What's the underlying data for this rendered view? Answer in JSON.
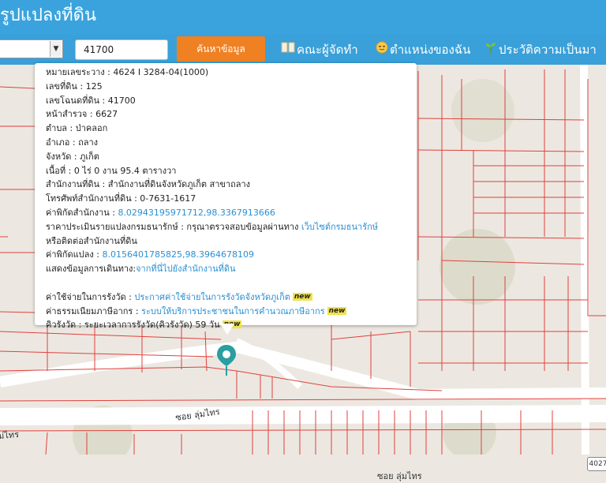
{
  "header": {
    "title": "รูปแปลงที่ดิน"
  },
  "toolbar": {
    "province_select_value": "",
    "deed_number_value": "41700",
    "search_button_label": "ค้นหาข้อมูล",
    "nav": [
      {
        "label": "คณะผู้จัดทำ",
        "icon": "book-icon"
      },
      {
        "label": "ตำแหน่งของฉัน",
        "icon": "face-icon"
      },
      {
        "label": "ประวัติความเป็นมา",
        "icon": "sprout-icon"
      }
    ]
  },
  "popup": {
    "survey_number": "หมายเลขระวาง : 4624 I 3284-04(1000)",
    "land_number": "เลขที่ดิน : 125",
    "deed_number": "เลขโฉนดที่ดิน : 41700",
    "survey_page": "หน้าสำรวจ : 6627",
    "subdistrict": "ตำบล : ป่าคลอก",
    "district": "อำเภอ : ถลาง",
    "province": "จังหวัด : ภูเก็ต",
    "area": "เนื้อที่ : 0 ไร่ 0 งาน 95.4 ตารางวา",
    "land_office": "สำนักงานที่ดิน : สำนักงานที่ดินจังหวัดภูเก็ต สาขาถลาง",
    "office_phone": "โทรศัพท์สำนักงานที่ดิน : 0-7631-1617",
    "office_coords_label": "ค่าพิกัดสำนักงาน : ",
    "office_coords_link": "8.02943195971712,98.3367913666",
    "appraisal_label": "ราคาประเมินรายแปลงกรมธนารักษ์ : กรุณาตรวจสอบข้อมูลผ่านทาง ",
    "appraisal_link": "เว็บไซต์กรมธนารักษ์",
    "appraisal_cont": "หรือติดต่อสำนักงานที่ดิน",
    "parcel_coords_label": "ค่าพิกัดแปลง : ",
    "parcel_coords_link": "8.0156401785825,98.3964678109",
    "directions_label": "แสดงข้อมูลการเดินทาง:",
    "directions_link": "จากที่นี่ไปยังสำนักงานที่ดิน",
    "fee_label": "ค่าใช้จ่ายในการรังวัด : ",
    "fee_link": "ประกาศค่าใช้จ่ายในการรังวัดจังหวัดภูเก็ต",
    "tax_label": "ค่าธรรมเนียมภาษีอากร : ",
    "tax_link": "ระบบให้บริการประชาชนในการคำนวณภาษีอากร",
    "queue_text": "คิวรังวัด : ระยะเวลาการรังวัด(คิวรังวัด) 59 วัน",
    "new_badge": "new"
  },
  "map": {
    "road_label_1": "ซอย ลุ่มไทร",
    "road_label_2": "ซอย ลุ่มไทร",
    "road_label_3": "ม่ไทร",
    "route_shield": "4027"
  },
  "colors": {
    "header_bg": "#3aa3dd",
    "search_button_bg": "#f08122",
    "link": "#2a8fd1",
    "parcel_line": "#e0413d",
    "pin": "#2a9ea0"
  }
}
